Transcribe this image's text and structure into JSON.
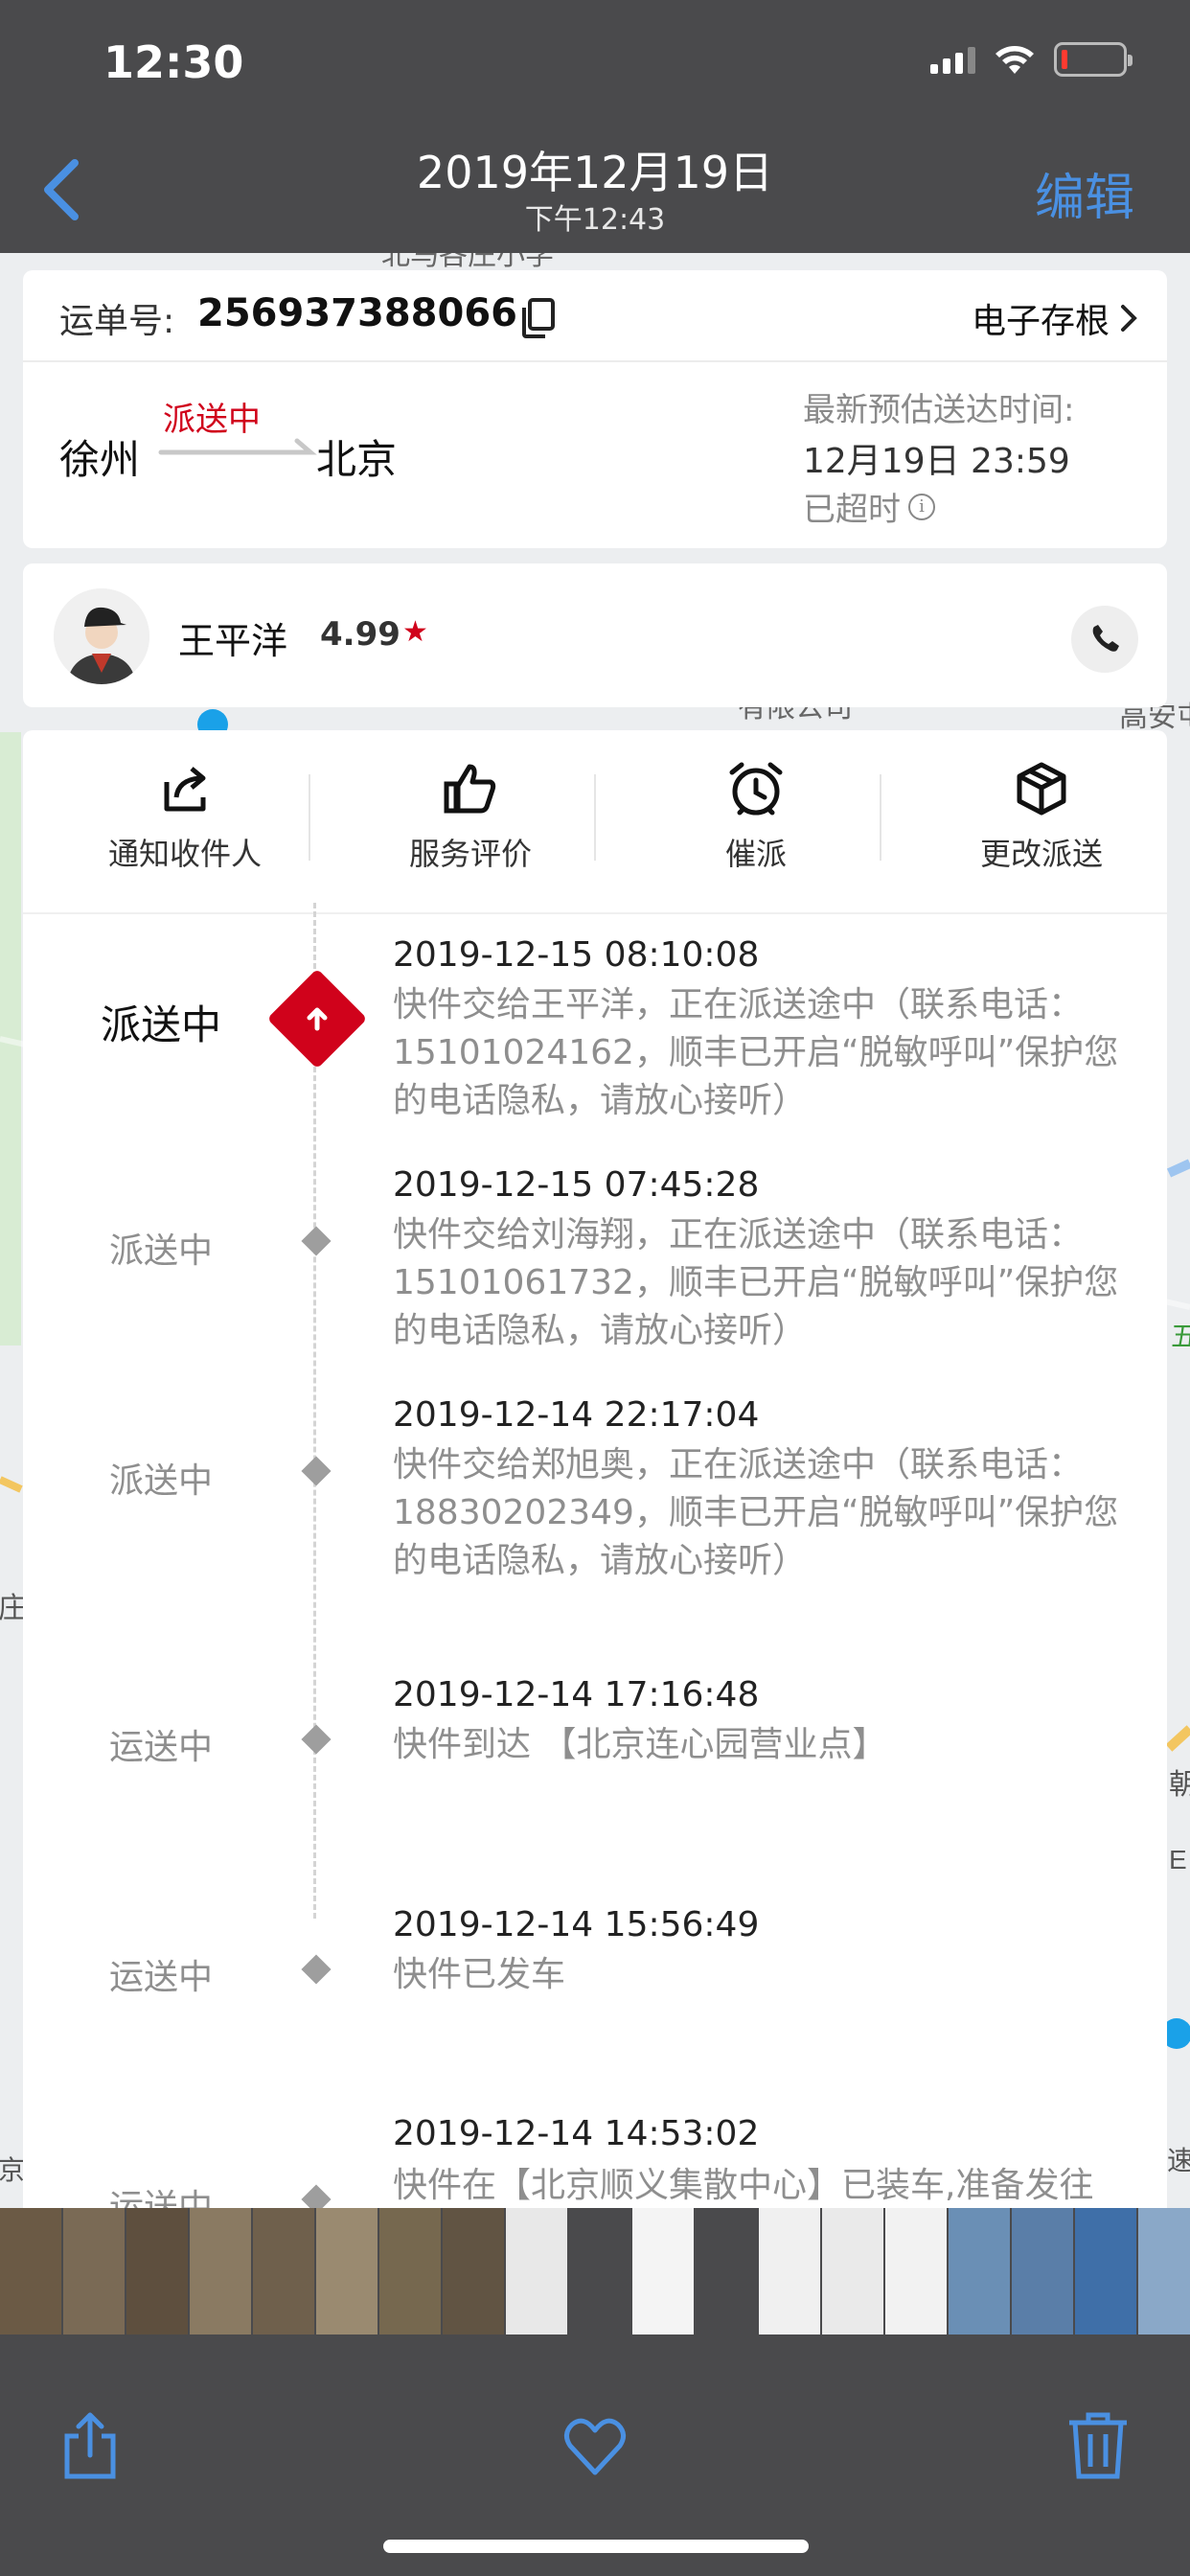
{
  "status_bar": {
    "time": "12:30"
  },
  "photo_nav": {
    "back_icon": "chevron-left-icon",
    "date": "2019年12月19日",
    "time": "下午12:43",
    "edit_label": "编辑"
  },
  "map": {
    "labels": [
      "北马各庄小学",
      "有限公司",
      "高安屯",
      "五",
      "E",
      "朝",
      "庄园",
      "京",
      "速"
    ]
  },
  "waybill": {
    "label": "运单号:",
    "number": "256937388066",
    "stub_label": "电子存根",
    "route": {
      "from": "徐州",
      "status": "派送中",
      "to": "北京"
    },
    "eta": {
      "label": "最新预估送达时间:",
      "time": "12月19日 23:59",
      "overdue": "已超时"
    }
  },
  "courier": {
    "name": "王平洋",
    "rating": "4.99"
  },
  "actions": [
    {
      "label": "通知收件人",
      "icon": "share-icon"
    },
    {
      "label": "服务评价",
      "icon": "thumbs-up-icon"
    },
    {
      "label": "催派",
      "icon": "alarm-clock-icon"
    },
    {
      "label": "更改派送",
      "icon": "box-icon"
    }
  ],
  "timeline": [
    {
      "status": "派送中",
      "time": "2019-12-15 08:10:08",
      "desc": "快件交给王平洋，正在派送途中（联系电话：15101024162，顺丰已开启“脱敏呼叫”保护您的电话隐私，请放心接听）"
    },
    {
      "status": "派送中",
      "time": "2019-12-15 07:45:28",
      "desc": "快件交给刘海翔，正在派送途中（联系电话：15101061732，顺丰已开启“脱敏呼叫”保护您的电话隐私，请放心接听）"
    },
    {
      "status": "派送中",
      "time": "2019-12-14 22:17:04",
      "desc": "快件交给郑旭奥，正在派送途中（联系电话：18830202349，顺丰已开启“脱敏呼叫”保护您的电话隐私，请放心接听）"
    },
    {
      "status": "运送中",
      "time": "2019-12-14 17:16:48",
      "desc": "快件到达 【北京连心园营业点】"
    },
    {
      "status": "运送中",
      "time": "2019-12-14 15:56:49",
      "desc": "快件已发车"
    },
    {
      "status": "运送中",
      "time": "2019-12-14 14:53:02",
      "desc": "快件在【北京顺义集散中心】已装车,准备发往下一站"
    }
  ],
  "toolbar": {
    "share_icon": "share-icon",
    "favorite_icon": "heart-icon",
    "delete_icon": "trash-icon"
  },
  "colors": {
    "accent": "#4a90e2",
    "sf_red": "#d0021b",
    "chrome": "#4a4a4c"
  }
}
